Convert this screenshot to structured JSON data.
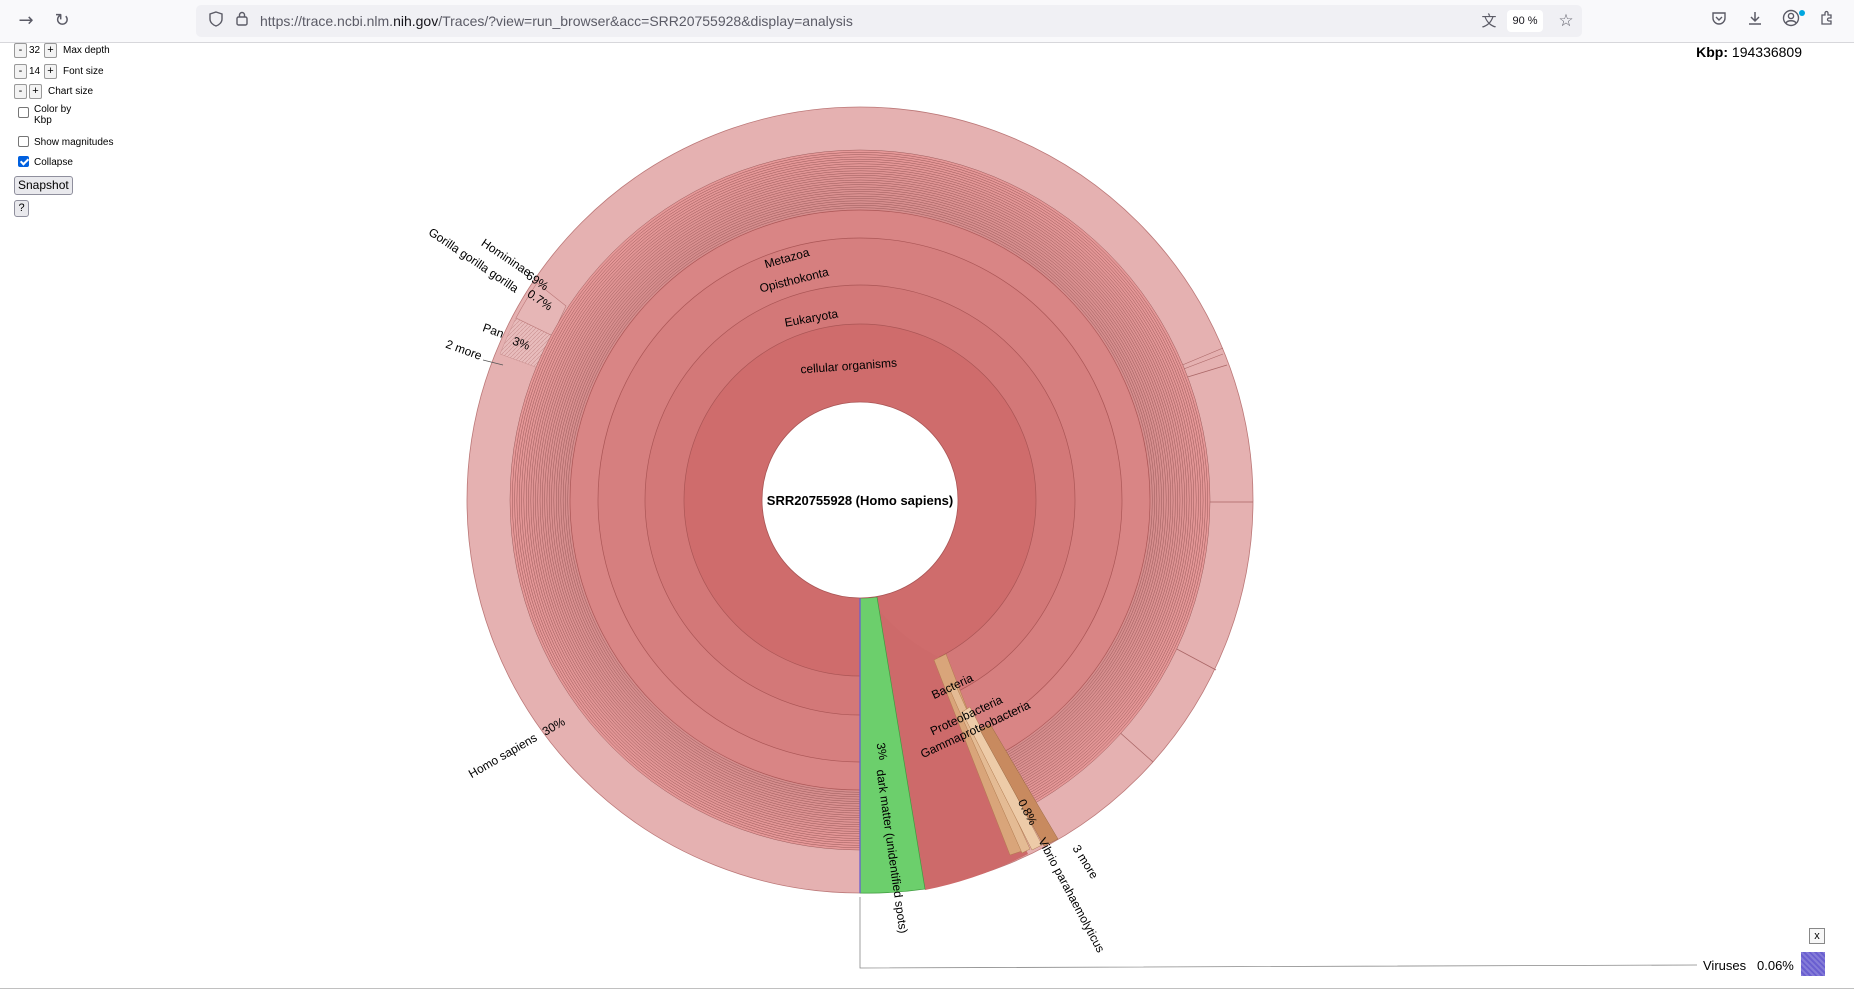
{
  "browser": {
    "url_prefix": "https://trace.ncbi.nlm.",
    "url_domain": "nih.gov",
    "url_suffix": "/Traces/?view=run_browser&acc=SRR20755928&display=analysis",
    "zoom": "90 %",
    "icons": [
      "forward-icon",
      "reload-icon",
      "shield-icon",
      "lock-icon",
      "translate-icon",
      "star-icon",
      "pocket-icon",
      "download-icon",
      "account-icon",
      "extensions-icon"
    ]
  },
  "controls": {
    "max_depth_value": "32",
    "max_depth_label": "Max depth",
    "font_size_value": "14",
    "font_size_label": "Font size",
    "chart_size_label": "Chart size",
    "minus": "-",
    "plus": "+",
    "color_by_line1": "Color by",
    "color_by_line2": "Kbp",
    "color_by_checked": false,
    "show_magnitudes_label": "Show magnitudes",
    "show_magnitudes_checked": false,
    "collapse_label": "Collapse",
    "collapse_checked": true,
    "snapshot_label": "Snapshot",
    "help_label": "?"
  },
  "summary": {
    "kbp_label": "Kbp:",
    "kbp_value": "194336809"
  },
  "details_panel": {
    "close_label": "x",
    "viruses_label": "Viruses",
    "viruses_pct": "0.06%"
  },
  "colors": {
    "eukaryota": "#d97a7a",
    "outer_ring": "#e5b1b1",
    "dark_matter": "#6ccf6c",
    "bacteria": "#d9a57a",
    "viruses": "#6a5fd0"
  },
  "chart_data": {
    "type": "krona",
    "root": "SRR20755928 (Homo sapiens)",
    "ring_labels": [
      "cellular organisms",
      "Eukaryota",
      "Opisthokonta",
      "Metazoa"
    ],
    "slices": [
      {
        "name": "dark matter (unidentified spots)",
        "percent": 3
      },
      {
        "name": "Bacteria",
        "percent": null
      },
      {
        "name": "Proteobacteria",
        "percent": null
      },
      {
        "name": "Gammaproteobacteria",
        "percent": null
      },
      {
        "name": "Vibrio parahaemolyticus",
        "percent": 0.8
      },
      {
        "name": "3 more",
        "percent": null
      },
      {
        "name": "Homininae",
        "percent": 69
      },
      {
        "name": "Gorilla gorilla gorilla",
        "percent": 0.7
      },
      {
        "name": "Pan",
        "percent": 3
      },
      {
        "name": "2 more",
        "percent": null
      },
      {
        "name": "Homo sapiens",
        "percent": 30
      },
      {
        "name": "Viruses",
        "percent": 0.06
      }
    ],
    "labels": {
      "dark_matter": "dark matter (unidentified spots)",
      "dark_matter_pct": "3%",
      "bacteria": "Bacteria",
      "proteobacteria": "Proteobacteria",
      "gammaproteobacteria": "Gammaproteobacteria",
      "vibrio": "Vibrio parahaemolyticus",
      "vibrio_pct": "0.8%",
      "three_more": "3 more",
      "homininae": "Homininae",
      "homininae_pct": "69%",
      "gorilla": "Gorilla gorilla gorilla",
      "gorilla_pct": "0.7%",
      "pan": "Pan",
      "pan_pct": "3%",
      "two_more": "2 more",
      "homo_sapiens": "Homo sapiens",
      "homo_sapiens_pct": "30%"
    }
  }
}
